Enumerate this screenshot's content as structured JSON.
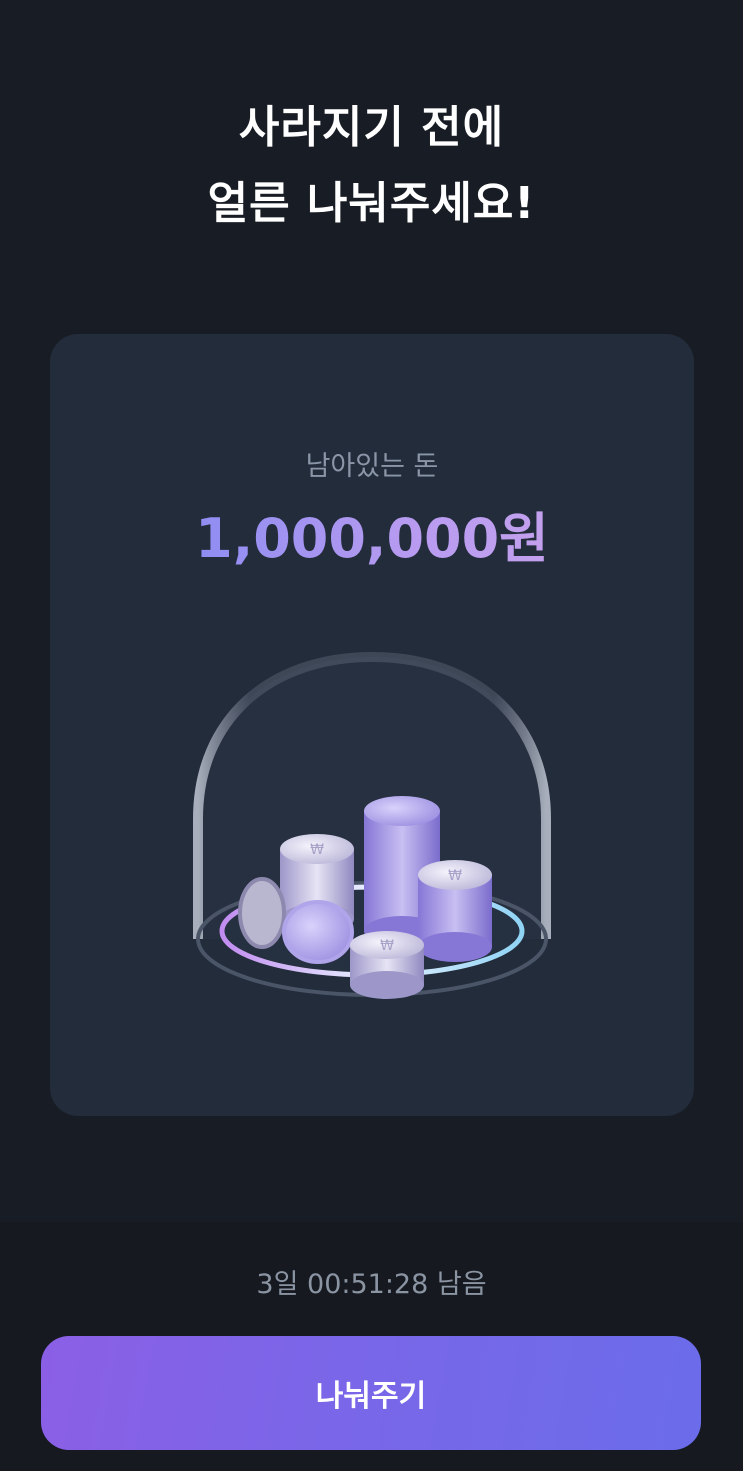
{
  "header": {
    "title_line1": "사라지기 전에",
    "title_line2": "얼른 나눠주세요!"
  },
  "card": {
    "label": "남아있는 돈",
    "amount": "1,000,000원",
    "illustration_icon": "coins-under-glass-dome-icon"
  },
  "footer": {
    "timer": "3일 00:51:28 남음",
    "cta_label": "나눠주기"
  },
  "colors": {
    "background": "#181c24",
    "card": "#222c3b",
    "amount_gradient_start": "#8f8df2",
    "amount_gradient_end": "#c3a0ee",
    "cta_gradient_start": "#8b5fe6",
    "cta_gradient_end": "#6b6cea"
  }
}
